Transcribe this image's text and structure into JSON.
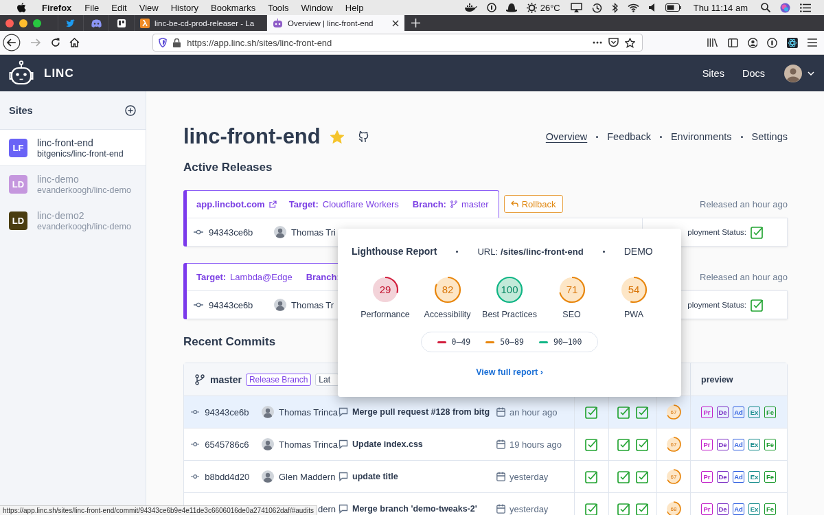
{
  "menubar": {
    "app": "Firefox",
    "menus": [
      "File",
      "Edit",
      "View",
      "History",
      "Bookmarks",
      "Tools",
      "Window",
      "Help"
    ],
    "temperature": "26°C",
    "clock": "Thu 11:14 am"
  },
  "browser_tabs": [
    {
      "title": "linc-be-cd-prod-releaser - La",
      "selected": false
    },
    {
      "title": "Overview | linc-front-end",
      "selected": true
    }
  ],
  "address_bar": {
    "url": "https://app.linc.sh/sites/linc-front-end"
  },
  "header": {
    "logo": "LINC",
    "nav": [
      "Sites",
      "Docs"
    ]
  },
  "sidebar": {
    "title": "Sites",
    "items": [
      {
        "initials": "LF",
        "name": "linc-front-end",
        "repo": "bitgenics/linc-front-end",
        "color": "#6a63f6",
        "selected": true
      },
      {
        "initials": "LD",
        "name": "linc-demo",
        "repo": "evanderkoogh/linc-demo",
        "color": "#c597de",
        "selected": false
      },
      {
        "initials": "LD",
        "name": "linc-demo2",
        "repo": "evanderkoogh/linc-demo",
        "color": "#4a3d10",
        "selected": false
      }
    ]
  },
  "site": {
    "title": "linc-front-end",
    "starred": true,
    "nav": [
      {
        "label": "Overview",
        "selected": true
      },
      {
        "label": "Feedback",
        "selected": false
      },
      {
        "label": "Environments",
        "selected": false
      },
      {
        "label": "Settings",
        "selected": false
      }
    ]
  },
  "active_releases": {
    "title": "Active Releases",
    "releases": [
      {
        "url": "app.lincbot.com",
        "target_label": "Target:",
        "target": "Cloudflare Workers",
        "branch_label": "Branch:",
        "branch": "master",
        "rollback": "Rollback",
        "released": "Released an hour ago",
        "commit": "94343ce6b",
        "author": "Thomas Tri",
        "status_label": "ployment Status:",
        "passed": true
      },
      {
        "target_label": "Target:",
        "target": "Lambda@Edge",
        "branch_label": "Branch:",
        "released": "Released an hour ago",
        "commit": "94343ce6b",
        "author": "Thomas Tr",
        "status_label": "ployment Status:",
        "passed": true
      }
    ]
  },
  "recent_commits": {
    "title": "Recent Commits",
    "branch": "master",
    "badges": [
      {
        "label": "Release Branch",
        "kind": "release"
      },
      {
        "label": "Lat",
        "kind": "plain"
      }
    ],
    "preview_heading": "preview",
    "rows": [
      {
        "hash": "94343ce6b",
        "author": "Thomas Trinca",
        "message": "Merge pull request #128 from bitg",
        "date": "an hour ago",
        "selected": true,
        "build_passed": true,
        "environments": [
          {
            "passed": true
          },
          {
            "passed": true
          }
        ],
        "lighthouse": "67",
        "previews": [
          {
            "label": "Pr",
            "color": "#c21fc9"
          },
          {
            "label": "De",
            "color": "#7a2fc4"
          },
          {
            "label": "Ad",
            "color": "#2d5ee0"
          },
          {
            "label": "Ex",
            "color": "#138a8a"
          },
          {
            "label": "Fe",
            "color": "#1c9a2e"
          }
        ]
      },
      {
        "hash": "6545786c6",
        "author": "Thomas Trinca",
        "message": "Update index.css",
        "date": "19 hours ago",
        "selected": false,
        "build_passed": true,
        "environments": [
          {
            "passed": true
          },
          {
            "passed": true
          }
        ],
        "lighthouse": "67",
        "previews": [
          {
            "label": "Pr",
            "color": "#c21fc9"
          },
          {
            "label": "De",
            "color": "#7a2fc4"
          },
          {
            "label": "Ad",
            "color": "#2d5ee0"
          },
          {
            "label": "Ex",
            "color": "#138a8a"
          },
          {
            "label": "Fe",
            "color": "#1c9a2e"
          }
        ]
      },
      {
        "hash": "b8bdd4d20",
        "author": "Glen Maddern",
        "message": "update title",
        "date": "yesterday",
        "selected": false,
        "build_passed": true,
        "environments": [
          {
            "passed": true
          },
          {
            "passed": true
          }
        ],
        "lighthouse": "67",
        "previews": [
          {
            "label": "Pr",
            "color": "#c21fc9"
          },
          {
            "label": "De",
            "color": "#7a2fc4"
          },
          {
            "label": "Ad",
            "color": "#2d5ee0"
          },
          {
            "label": "Ex",
            "color": "#138a8a"
          },
          {
            "label": "Fe",
            "color": "#1c9a2e"
          }
        ]
      },
      {
        "author": "dern",
        "message": "Merge branch 'demo-tweaks-2'",
        "date": "yesterday",
        "selected": false,
        "build_passed": true,
        "environments": [
          {
            "passed": true
          },
          {
            "passed": true
          }
        ],
        "lighthouse": "68",
        "previews": [
          {
            "label": "Pr",
            "color": "#c21fc9"
          },
          {
            "label": "De",
            "color": "#7a2fc4"
          },
          {
            "label": "Ad",
            "color": "#2d5ee0"
          },
          {
            "label": "Ex",
            "color": "#138a8a"
          },
          {
            "label": "Fe",
            "color": "#1c9a2e"
          }
        ]
      }
    ]
  },
  "lighthouse_popup": {
    "title": "Lighthouse Report",
    "url_label": "URL:",
    "url": "/sites/linc-front-end",
    "environment": "DEMO",
    "scores": [
      {
        "score": "29",
        "label": "Performance",
        "kind": "poor"
      },
      {
        "score": "82",
        "label": "Accessibility",
        "kind": "average"
      },
      {
        "score": "100",
        "label": "Best Practices",
        "kind": "good"
      },
      {
        "score": "71",
        "label": "SEO",
        "kind": "average"
      },
      {
        "score": "54",
        "label": "PWA",
        "kind": "average"
      }
    ],
    "legend": [
      {
        "range": "0–49",
        "kind": "poor"
      },
      {
        "range": "50–89",
        "kind": "average"
      },
      {
        "range": "90–100",
        "kind": "good"
      }
    ],
    "link": "View full report ›"
  },
  "status_url": "https://app.linc.sh/sites/linc-front-end/commit/94343ce6b9e4e11de3c6606016de0a2741062daf/#audits"
}
